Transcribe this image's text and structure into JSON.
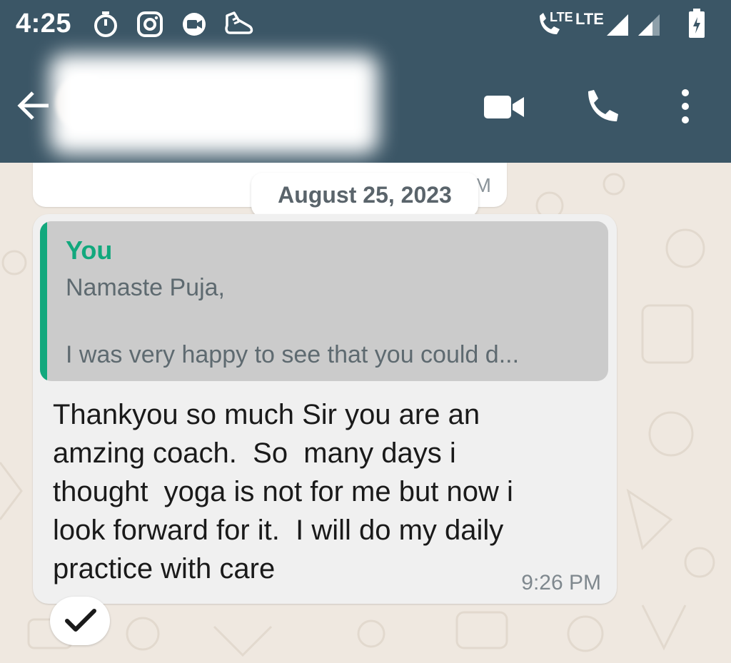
{
  "status_bar": {
    "time": "4:25",
    "icons": [
      "timer-icon",
      "instagram-icon",
      "meet-icon",
      "shoe-icon",
      "wifi-call-icon",
      "signal-icon",
      "battery-icon"
    ],
    "network_label_1": "LTE",
    "network_label_2": "LTE"
  },
  "header": {
    "contact_name_visible": "t",
    "icons": [
      "back-arrow-icon",
      "video-call-icon",
      "phone-icon",
      "more-icon"
    ],
    "background": "#3b5666"
  },
  "chat": {
    "previous_message_time_partial": "M",
    "date_separator": "August 25, 2023",
    "message": {
      "quote": {
        "author": "You",
        "line1": "Namaste Puja,",
        "line2": "I was very happy to see that you could d..."
      },
      "text": "Thankyou so much Sir you are an\namzing coach.  So  many days i\nthought  yoga is not for me but now i\nlook forward for it.  I will do my daily\npractice with care",
      "time": "9:26 PM"
    },
    "accent_color": "#12a87d"
  }
}
